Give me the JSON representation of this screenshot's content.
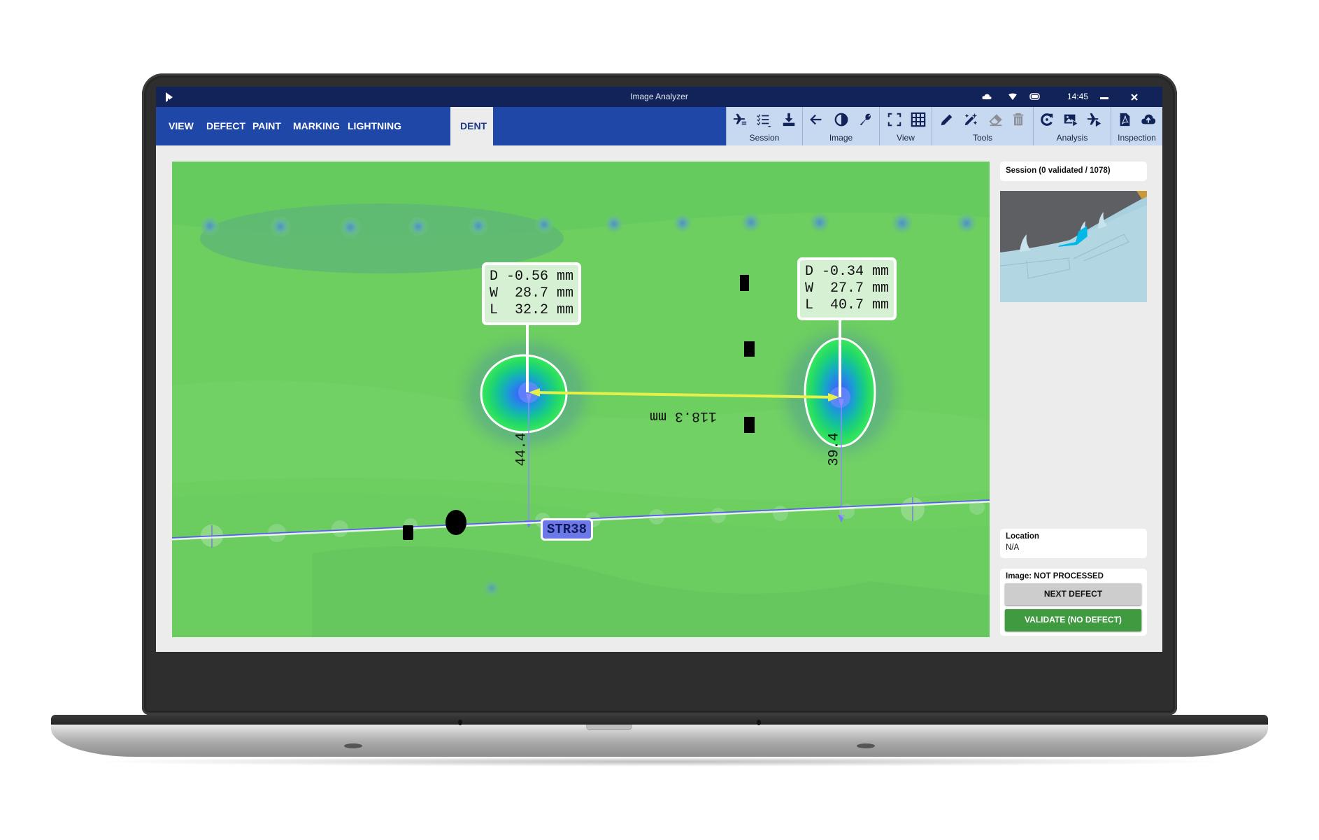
{
  "window": {
    "title": "Image Analyzer",
    "clock": "14:45",
    "status_icons": [
      "cloud-icon",
      "wifi-icon",
      "battery-icon"
    ],
    "minimize_icon": "minimize-icon",
    "close_icon": "close-icon"
  },
  "tabs": [
    {
      "label": "VIEW",
      "active": false
    },
    {
      "label": "DEFECT",
      "active": false
    },
    {
      "label": "PAINT",
      "active": false
    },
    {
      "label": "MARKING",
      "active": false
    },
    {
      "label": "LIGHTNING",
      "active": false
    },
    {
      "label": "DENT",
      "active": true
    }
  ],
  "toolbar": {
    "groups": [
      {
        "label": "Session",
        "icons": [
          "aircraft-transfer-icon",
          "checklist-dropdown-icon",
          "download-icon"
        ]
      },
      {
        "label": "Image",
        "icons": [
          "arrow-left-icon",
          "contrast-icon",
          "wrench-icon"
        ]
      },
      {
        "label": "View",
        "icons": [
          "fullscreen-icon",
          "grid-icon"
        ]
      },
      {
        "label": "Tools",
        "icons": [
          "pencil-icon",
          "auto-edit-icon",
          "eraser-icon",
          "trash-icon"
        ]
      },
      {
        "label": "Analysis",
        "icons": [
          "refresh-icon",
          "image-play-icon",
          "aircraft-play-icon"
        ]
      },
      {
        "label": "Inspection",
        "icons": [
          "pdf-icon",
          "cloud-upload-icon"
        ]
      }
    ]
  },
  "viewer": {
    "dents": [
      {
        "depth": "D -0.56 mm",
        "width": "W  28.7 mm",
        "length": "L  32.2 mm",
        "distance_to_stringer": "44.4"
      },
      {
        "depth": "D -0.34 mm",
        "width": "W  27.7 mm",
        "length": "L  40.7 mm",
        "distance_to_stringer": "39.4"
      }
    ],
    "dent_spacing": "118.3 mm",
    "stringer_label": "STR38",
    "colors": {
      "measure_line": "#e6f04a",
      "stringer_line": "#5a5ef0",
      "label_bg": "#6b78e8"
    }
  },
  "sidebar": {
    "session": "Session (0 validated / 1078)",
    "location_label": "Location",
    "location_value": "N/A",
    "image_status_label": "Image:",
    "image_status_value": "NOT PROCESSED",
    "next_defect_button": "NEXT DEFECT",
    "validate_button": "VALIDATE (NO DEFECT)",
    "validate_color": "#3f9a40"
  }
}
